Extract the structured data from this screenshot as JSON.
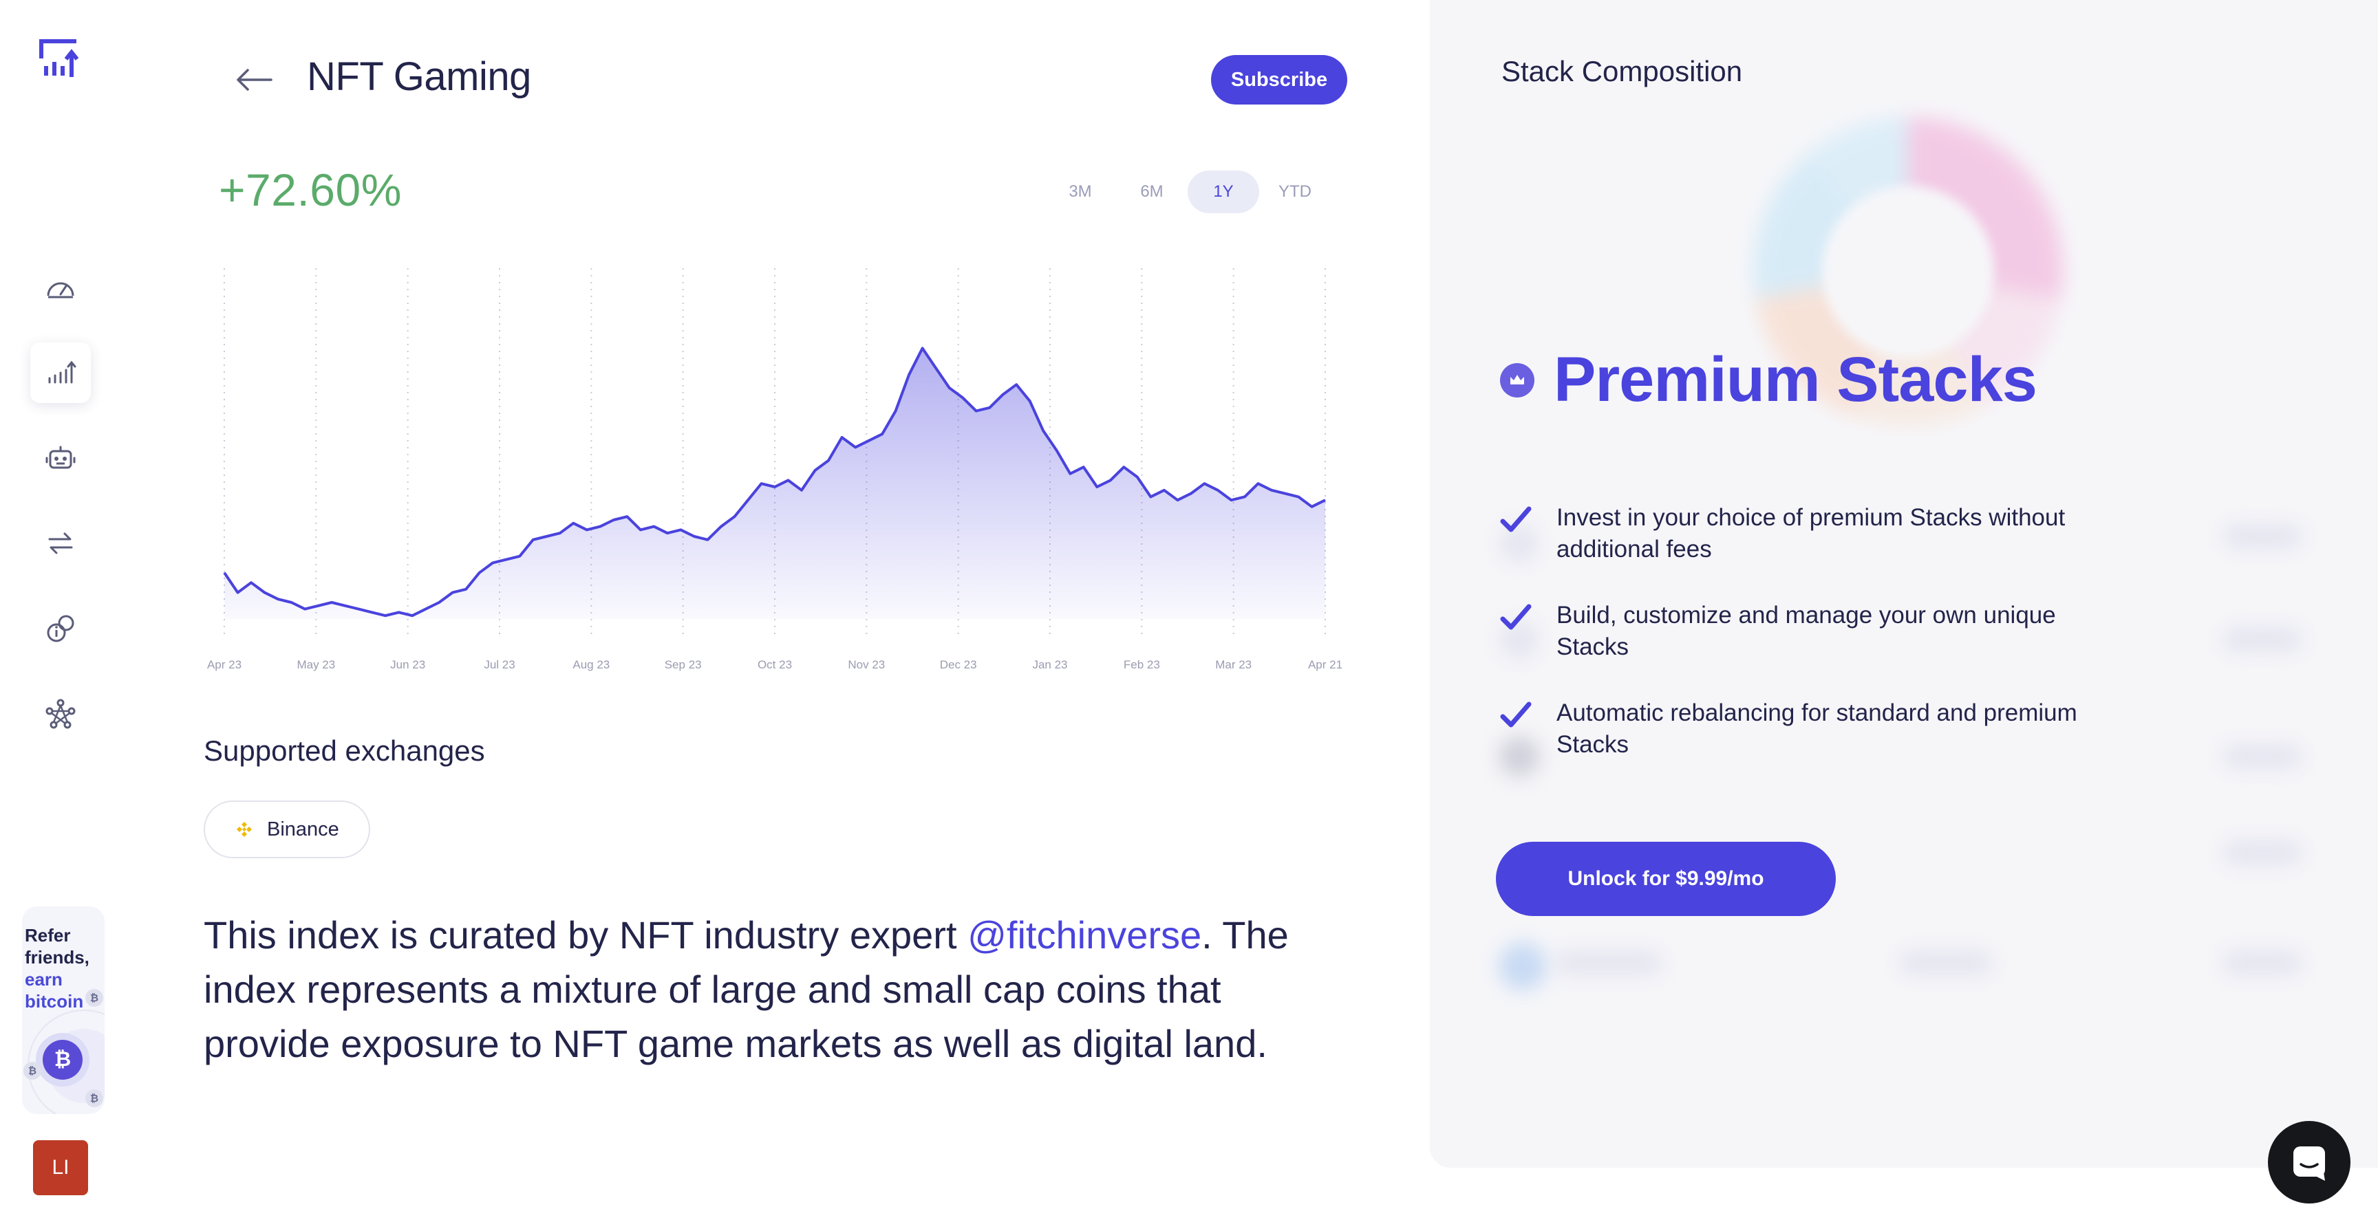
{
  "sidebar": {
    "logo_icon": "bar-chart-up-logo",
    "nav": [
      {
        "icon": "dashboard-gauge-icon",
        "active": false
      },
      {
        "icon": "bar-chart-icon",
        "active": true
      },
      {
        "icon": "robot-icon",
        "active": false
      },
      {
        "icon": "swap-arrows-icon",
        "active": false
      },
      {
        "icon": "info-coin-icon",
        "active": false
      },
      {
        "icon": "network-nodes-icon",
        "active": false
      }
    ],
    "refer": {
      "line1": "Refer",
      "line2": "friends,",
      "line3": "earn",
      "line4": "bitcoin",
      "coin_symbol": "₿",
      "mini_badge": "₿"
    },
    "avatar_initials": "LI",
    "avatar_color": "#bc3a26"
  },
  "header": {
    "back_icon": "arrow-left-icon",
    "title": "NFT Gaming",
    "subscribe_label": "Subscribe"
  },
  "performance": {
    "change": "+72.60%",
    "ranges": [
      "3M",
      "6M",
      "1Y",
      "YTD"
    ],
    "active_range": "1Y"
  },
  "chart_data": {
    "type": "area",
    "title": "",
    "xlabel": "",
    "ylabel": "",
    "x_tick_labels": [
      "Apr 23",
      "May 23",
      "Jun 23",
      "Jul 23",
      "Aug 23",
      "Sep 23",
      "Oct 23",
      "Nov 23",
      "Dec 23",
      "Jan 23",
      "Feb 23",
      "Mar 23",
      "Apr 21"
    ],
    "grid": "vertical-dotted",
    "color": "#4a43dd",
    "ylim": [
      0,
      100
    ],
    "series": [
      {
        "values": [
          14,
          8,
          11,
          8,
          6,
          5,
          3,
          4,
          5,
          4,
          3,
          2,
          1,
          2,
          1,
          3,
          5,
          8,
          9,
          14,
          17,
          18,
          19,
          24,
          25,
          26,
          29,
          27,
          28,
          30,
          31,
          27,
          28,
          26,
          27,
          25,
          24,
          28,
          31,
          36,
          41,
          40,
          42,
          39,
          45,
          48,
          55,
          52,
          54,
          56,
          63,
          74,
          82,
          76,
          70,
          67,
          63,
          64,
          68,
          71,
          66,
          57,
          51,
          44,
          46,
          40,
          42,
          46,
          43,
          37,
          39,
          36,
          38,
          41,
          39,
          36,
          37,
          41,
          39,
          38,
          37,
          34,
          36
        ]
      }
    ]
  },
  "exchanges": {
    "title": "Supported exchanges",
    "items": [
      {
        "name": "Binance",
        "icon": "binance-icon",
        "color": "#f0b90b"
      }
    ]
  },
  "description": {
    "before": "This index is curated by NFT industry expert ",
    "handle": "@fitchinverse",
    "after": ". The index represents a mixture of large and small cap coins that provide exposure to NFT game markets as well as digital land."
  },
  "right_panel": {
    "title": "Stack Composition",
    "premium_icon": "crown-icon",
    "premium_title": "Premium Stacks",
    "features": [
      "Invest in your choice of premium Stacks without additional fees",
      "Build, customize and manage your own unique Stacks",
      "Automatic rebalancing for standard and premium Stacks"
    ],
    "check_icon": "checkmark-icon",
    "unlock_label": "Unlock for $9.99/mo"
  },
  "chat": {
    "icon": "chat-bubble-icon"
  }
}
